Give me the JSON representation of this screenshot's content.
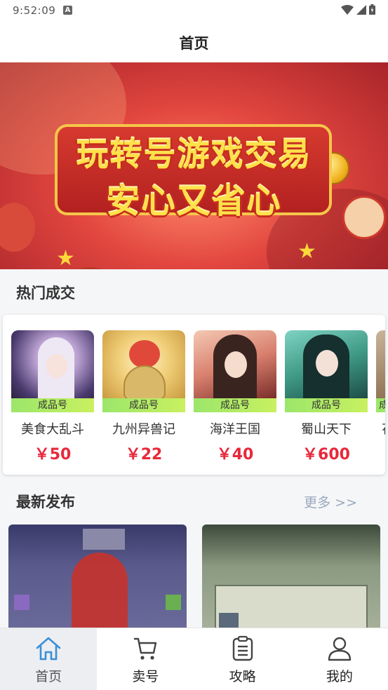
{
  "status_bar": {
    "time": "9:52:09",
    "a_badge": "A"
  },
  "header": {
    "title": "首页"
  },
  "banner": {
    "line1": "玩转号游戏交易",
    "line2": "安心又省心",
    "dots": 2,
    "active_dot": 0
  },
  "hot_section": {
    "title": "热门成交",
    "items": [
      {
        "tag": "成品号",
        "name": "美食大乱斗",
        "price": "￥50"
      },
      {
        "tag": "成品号",
        "name": "九州异兽记",
        "price": "￥22"
      },
      {
        "tag": "成品号",
        "name": "海洋王国",
        "price": "￥40"
      },
      {
        "tag": "成品号",
        "name": "蜀山天下",
        "price": "￥600"
      },
      {
        "tag": "成",
        "name": "花",
        "price": ""
      }
    ]
  },
  "new_section": {
    "title": "最新发布",
    "more": "更多 >>"
  },
  "tabbar": {
    "tabs": [
      {
        "label": "首页",
        "icon": "home-icon",
        "active": true
      },
      {
        "label": "卖号",
        "icon": "cart-icon",
        "active": false
      },
      {
        "label": "攻略",
        "icon": "clipboard-icon",
        "active": false
      },
      {
        "label": "我的",
        "icon": "user-icon",
        "active": false
      }
    ]
  },
  "colors": {
    "accent": "#3b8fd6",
    "price": "#e8283a",
    "tag_green": "#b6ec66",
    "more": "#9aa9bd"
  }
}
